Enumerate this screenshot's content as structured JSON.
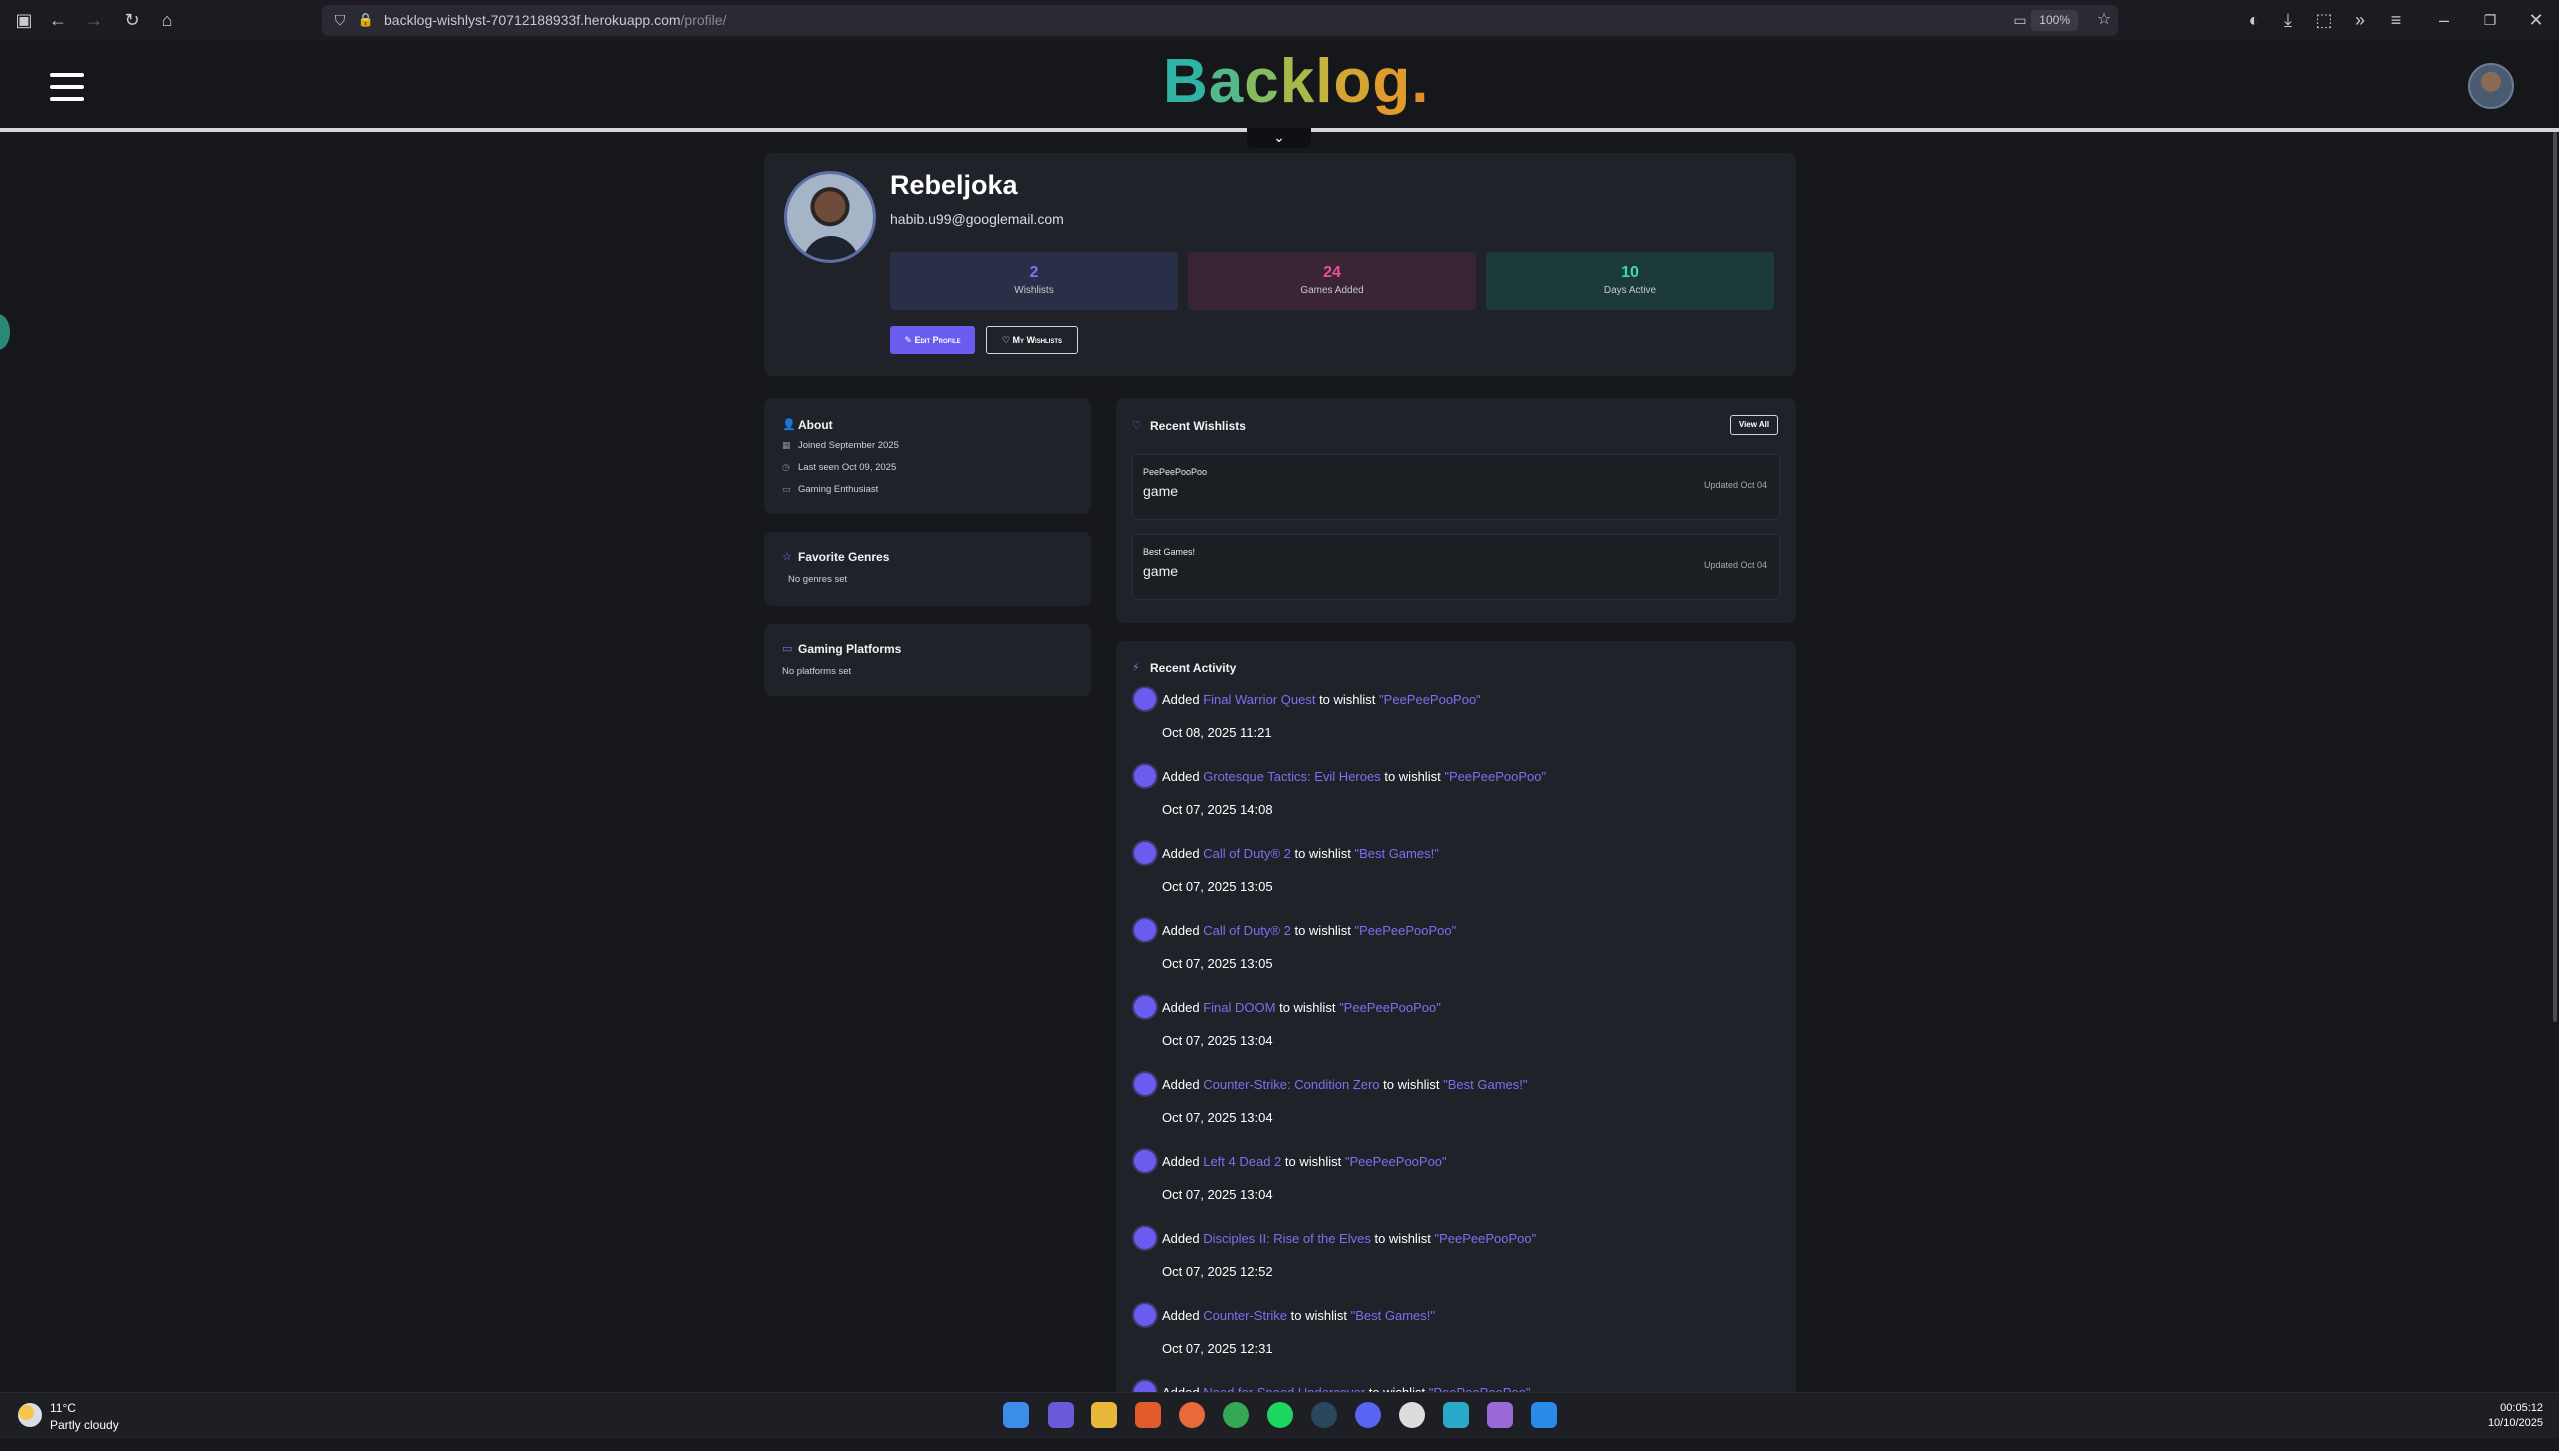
{
  "browser": {
    "url_main": "backlog-wishlyst-70712188933f.herokuapp.com",
    "url_path": "/profile/",
    "zoom": "100%"
  },
  "site": {
    "logo_letters": [
      "B",
      "a",
      "c",
      "k",
      "l",
      "o",
      "g",
      "."
    ]
  },
  "profile": {
    "name": "Rebeljoka",
    "email": "habib.u99@googlemail.com",
    "stats": [
      {
        "value": "2",
        "label": "Wishlists"
      },
      {
        "value": "24",
        "label": "Games Added"
      },
      {
        "value": "10",
        "label": "Days Active"
      }
    ],
    "edit_label": "Edit Profile",
    "wishlists_label": "My Wishlists"
  },
  "about": {
    "title": "About",
    "joined": "Joined September 2025",
    "last_seen": "Last seen Oct 09, 2025",
    "role": "Gaming Enthusiast"
  },
  "genres": {
    "title": "Favorite Genres",
    "empty": "No genres set"
  },
  "platforms": {
    "title": "Gaming Platforms",
    "empty": "No platforms set"
  },
  "recent_wishlists": {
    "title": "Recent Wishlists",
    "view_all": "View All",
    "items": [
      {
        "name": "PeePeePooPoo",
        "desc": "game",
        "updated": "Updated Oct 04"
      },
      {
        "name": "Best Games!",
        "desc": "game",
        "updated": "Updated Oct 04"
      }
    ]
  },
  "activity": {
    "title": "Recent Activity",
    "items": [
      {
        "verb": "Added",
        "game": "Final Warrior Quest",
        "mid": "to wishlist",
        "wishlist": "\"PeePeePooPoo\"",
        "time": "Oct 08, 2025 11:21"
      },
      {
        "verb": "Added",
        "game": "Grotesque Tactics: Evil Heroes",
        "mid": "to wishlist",
        "wishlist": "\"PeePeePooPoo\"",
        "time": "Oct 07, 2025 14:08"
      },
      {
        "verb": "Added",
        "game": "Call of Duty® 2",
        "mid": "to wishlist",
        "wishlist": "\"Best Games!\"",
        "time": "Oct 07, 2025 13:05"
      },
      {
        "verb": "Added",
        "game": "Call of Duty® 2",
        "mid": "to wishlist",
        "wishlist": "\"PeePeePooPoo\"",
        "time": "Oct 07, 2025 13:05"
      },
      {
        "verb": "Added",
        "game": "Final DOOM",
        "mid": "to wishlist",
        "wishlist": "\"PeePeePooPoo\"",
        "time": "Oct 07, 2025 13:04"
      },
      {
        "verb": "Added",
        "game": "Counter-Strike: Condition Zero",
        "mid": "to wishlist",
        "wishlist": "\"Best Games!\"",
        "time": "Oct 07, 2025 13:04"
      },
      {
        "verb": "Added",
        "game": "Left 4 Dead 2",
        "mid": "to wishlist",
        "wishlist": "\"PeePeePooPoo\"",
        "time": "Oct 07, 2025 13:04"
      },
      {
        "verb": "Added",
        "game": "Disciples II: Rise of the Elves",
        "mid": "to wishlist",
        "wishlist": "\"PeePeePooPoo\"",
        "time": "Oct 07, 2025 12:52"
      },
      {
        "verb": "Added",
        "game": "Counter-Strike",
        "mid": "to wishlist",
        "wishlist": "\"Best Games!\"",
        "time": "Oct 07, 2025 12:31"
      },
      {
        "verb": "Added",
        "game": "Need for Speed Undercover",
        "mid": "to wishlist",
        "wishlist": "\"PeePeePooPoo\"",
        "time": ""
      }
    ]
  },
  "taskbar": {
    "temp": "11°C",
    "weather": "Partly cloudy",
    "time": "00:05:12",
    "date": "10/10/2025"
  }
}
